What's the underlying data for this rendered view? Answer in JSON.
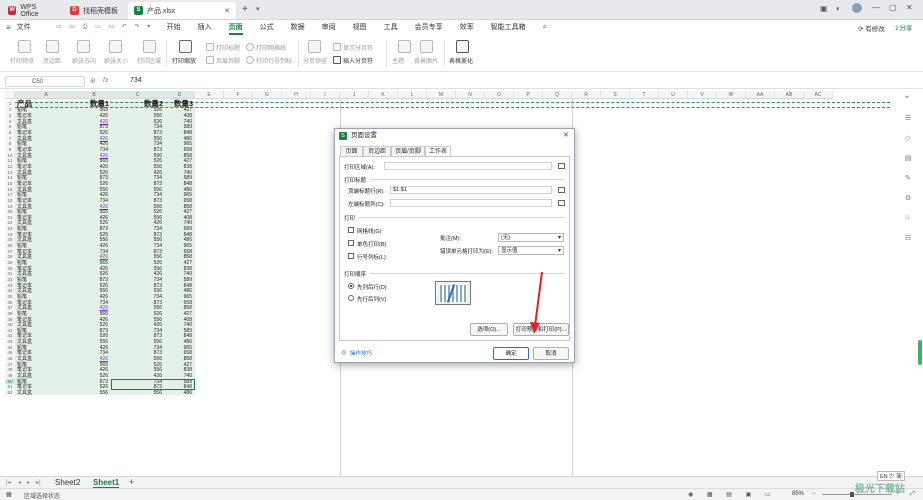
{
  "window": {
    "tabs": [
      {
        "label": "WPS Office",
        "active": false
      },
      {
        "label": "找稻壳模板",
        "active": false
      },
      {
        "label": "产品.xlsx",
        "active": true
      }
    ],
    "new_tab": "+",
    "right_actions": {
      "edit_label": "有修改",
      "share_label": "分享"
    }
  },
  "menu": {
    "file": "文件",
    "items": [
      "开始",
      "插入",
      "页面",
      "公式",
      "数据",
      "审阅",
      "视图",
      "工具",
      "会员专享",
      "效率",
      "智能工具箱"
    ],
    "active": "页面"
  },
  "ribbon": {
    "groups": [
      {
        "label": "打印预览"
      },
      {
        "label": "页边距"
      },
      {
        "label": "纸张方向"
      },
      {
        "label": "纸张大小"
      },
      {
        "label": "打印区域"
      },
      {
        "label": "打印缩放"
      },
      {
        "label": "打印标题"
      },
      {
        "label": "页眉页脚"
      },
      {
        "label": "打印网格线"
      },
      {
        "label": "打印行号列标"
      },
      {
        "label": "分页预览"
      },
      {
        "label": "显示分页符"
      },
      {
        "label": "插入分页符"
      },
      {
        "label": "主题"
      },
      {
        "label": "背景图片"
      },
      {
        "label": "表格美化"
      }
    ]
  },
  "formula_bar": {
    "cell_ref": "C50",
    "fx": "fx",
    "value": "734"
  },
  "columns": [
    "A",
    "B",
    "C",
    "D",
    "E",
    "F",
    "G",
    "H",
    "I",
    "J",
    "K",
    "L",
    "M",
    "N",
    "O",
    "P",
    "Q",
    "R",
    "S",
    "T",
    "U",
    "V",
    "W",
    "AA",
    "AB",
    "AC"
  ],
  "sheet": {
    "header": [
      "产品",
      "数量1",
      "数量2",
      "数量3"
    ],
    "rows": [
      [
        "铅笔",
        "565",
        "526",
        "427"
      ],
      [
        "笔记本",
        "426",
        "556",
        "408"
      ],
      [
        "文具盒",
        "426",
        "526",
        "740"
      ],
      [
        "铅笔",
        "873",
        "734",
        "589"
      ],
      [
        "笔记本",
        "526",
        "873",
        "848"
      ],
      [
        "文具盒",
        "426",
        "556",
        "486"
      ],
      [
        "铅笔",
        "426",
        "734",
        "965"
      ],
      [
        "笔记本",
        "734",
        "873",
        "658"
      ],
      [
        "文具盒",
        "426",
        "556",
        "858"
      ],
      [
        "铅笔",
        "565",
        "526",
        "427"
      ],
      [
        "笔记本",
        "426",
        "556",
        "838"
      ],
      [
        "文具盒",
        "526",
        "426",
        "740"
      ],
      [
        "铅笔",
        "873",
        "734",
        "589"
      ],
      [
        "笔记本",
        "526",
        "873",
        "848"
      ],
      [
        "文具盒",
        "556",
        "556",
        "486"
      ],
      [
        "铅笔",
        "426",
        "734",
        "965"
      ],
      [
        "笔记本",
        "734",
        "873",
        "658"
      ],
      [
        "文具盒",
        "426",
        "556",
        "858"
      ],
      [
        "铅笔",
        "565",
        "526",
        "427"
      ],
      [
        "笔记本",
        "426",
        "556",
        "408"
      ],
      [
        "文具盒",
        "526",
        "426",
        "740"
      ],
      [
        "铅笔",
        "873",
        "734",
        "589"
      ],
      [
        "笔记本",
        "526",
        "873",
        "848"
      ],
      [
        "文具盒",
        "556",
        "556",
        "486"
      ],
      [
        "铅笔",
        "426",
        "734",
        "965"
      ],
      [
        "笔记本",
        "734",
        "873",
        "658"
      ],
      [
        "文具盒",
        "426",
        "556",
        "858"
      ],
      [
        "铅笔",
        "565",
        "526",
        "427"
      ],
      [
        "笔记本",
        "426",
        "556",
        "838"
      ],
      [
        "文具盒",
        "526",
        "426",
        "740"
      ],
      [
        "铅笔",
        "873",
        "734",
        "589"
      ],
      [
        "笔记本",
        "526",
        "873",
        "848"
      ],
      [
        "文具盒",
        "556",
        "556",
        "486"
      ],
      [
        "铅笔",
        "426",
        "734",
        "965"
      ],
      [
        "笔记本",
        "734",
        "873",
        "658"
      ],
      [
        "文具盒",
        "426",
        "556",
        "858"
      ],
      [
        "铅笔",
        "565",
        "526",
        "427"
      ],
      [
        "笔记本",
        "426",
        "556",
        "408"
      ],
      [
        "文具盒",
        "526",
        "426",
        "740"
      ],
      [
        "铅笔",
        "873",
        "734",
        "589"
      ],
      [
        "笔记本",
        "526",
        "873",
        "848"
      ],
      [
        "文具盒",
        "556",
        "556",
        "486"
      ],
      [
        "铅笔",
        "426",
        "734",
        "965"
      ],
      [
        "笔记本",
        "734",
        "873",
        "658"
      ],
      [
        "文具盒",
        "426",
        "556",
        "858"
      ],
      [
        "铅笔",
        "565",
        "526",
        "427"
      ],
      [
        "笔记本",
        "426",
        "556",
        "838"
      ],
      [
        "文具盒",
        "526",
        "426",
        "740"
      ],
      [
        "铅笔",
        "873",
        "734",
        "589"
      ],
      [
        "笔记本",
        "526",
        "873",
        "848"
      ],
      [
        "文具盒",
        "556",
        "556",
        "486"
      ]
    ]
  },
  "sheet_tabs": [
    "Sheet2",
    "Sheet1"
  ],
  "active_sheet": "Sheet1",
  "status": {
    "left": "区域选择状态",
    "zoom": "85%",
    "ime": "EN 少 简"
  },
  "dialog": {
    "title": "页面设置",
    "tabs": [
      "页面",
      "页边距",
      "页眉/页脚",
      "工作表"
    ],
    "active_tab": "工作表",
    "print_area_label": "打印区域(A):",
    "print_titles_label": "打印标题",
    "top_rows_label": "顶端标题行(R):",
    "top_rows_value": "$1:$1",
    "left_cols_label": "左端标题列(C):",
    "print_label": "打印",
    "gridlines_label": "网格线(G)",
    "mono_label": "单色打印(B)",
    "rowcol_label": "行号列标(L)",
    "comments_label": "批注(M):",
    "comments_value": "(无)",
    "errors_label": "错误单元格打印为(E):",
    "errors_value": "显示值",
    "order_label": "打印顺序",
    "down_then_over": "先列后行(D)",
    "over_then_down": "先行后列(V)",
    "options_btn": "选项(O)...",
    "preview_btn": "打印预览和打印(P)...",
    "tips_label": "操作技巧",
    "ok_btn": "确定",
    "cancel_btn": "取消"
  },
  "watermark": "极光下载站",
  "colors": {
    "accent": "#1e7e4a",
    "arrow": "#e0202a",
    "primary_btn": "#2b6bd1"
  }
}
